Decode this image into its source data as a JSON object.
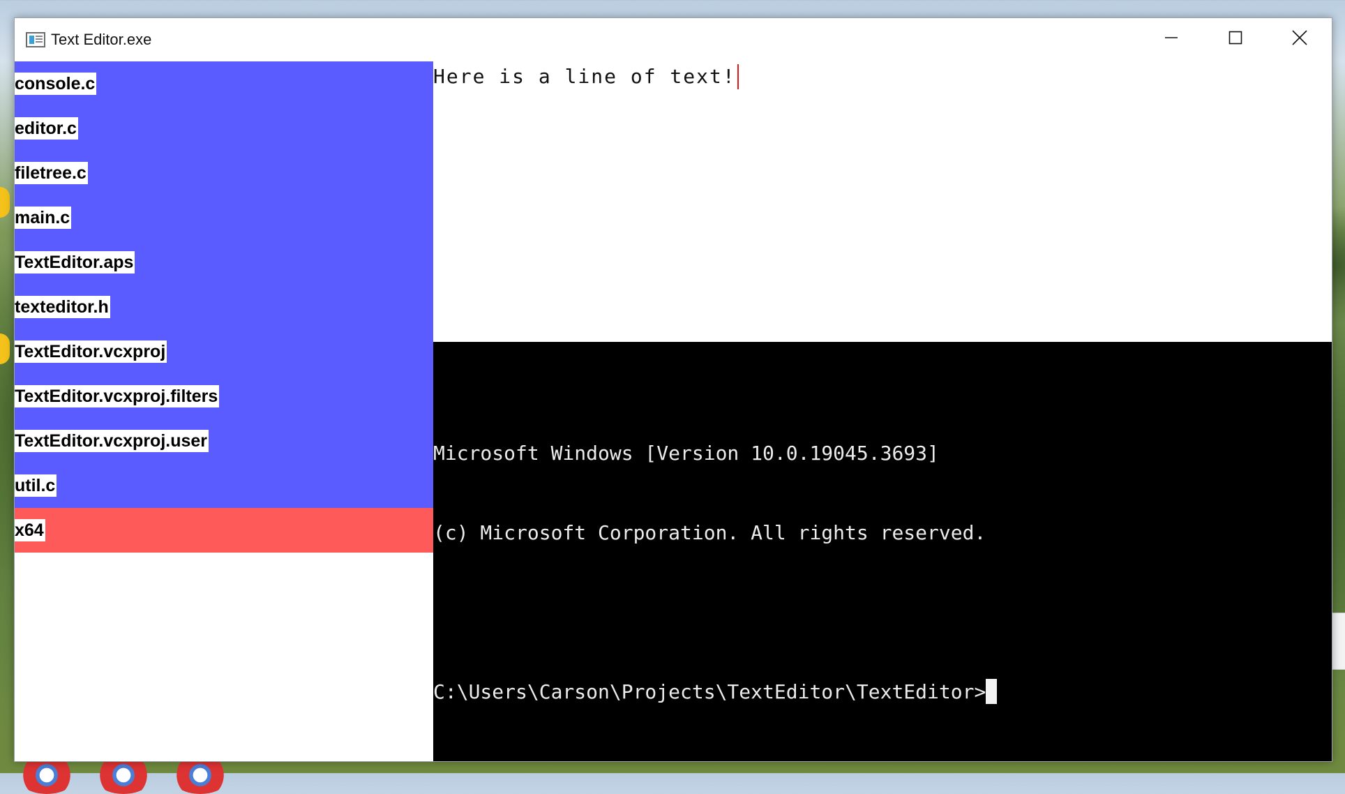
{
  "window": {
    "title": "Text Editor.exe",
    "controls": {
      "minimize_icon": "minimize-icon",
      "maximize_icon": "maximize-icon",
      "close_icon": "close-icon"
    }
  },
  "file_tree": {
    "items": [
      {
        "label": "console.c"
      },
      {
        "label": "editor.c"
      },
      {
        "label": "filetree.c"
      },
      {
        "label": "main.c"
      },
      {
        "label": "TextEditor.aps"
      },
      {
        "label": "texteditor.h"
      },
      {
        "label": "TextEditor.vcxproj"
      },
      {
        "label": "TextEditor.vcxproj.filters"
      },
      {
        "label": "TextEditor.vcxproj.user"
      },
      {
        "label": "util.c"
      },
      {
        "label": "x64",
        "selected": true
      }
    ],
    "colors": {
      "item_bg": "#5a5cff",
      "selected_bg": "#ff5a5a"
    }
  },
  "editor": {
    "lines": [
      "Here is a line of text!"
    ],
    "caret_color": "#e01818"
  },
  "console": {
    "lines": [
      "Microsoft Windows [Version 10.0.19045.3693]",
      "(c) Microsoft Corporation. All rights reserved.",
      ""
    ],
    "prompt": "C:\\Users\\Carson\\Projects\\TextEditor\\TextEditor>"
  }
}
